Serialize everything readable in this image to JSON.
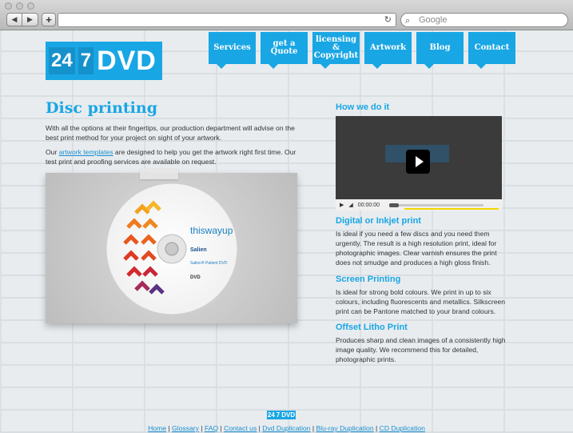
{
  "browser": {
    "url": "",
    "search_placeholder": "Google",
    "add_label": "+",
    "back_label": "◀",
    "forward_label": "▶"
  },
  "logo": {
    "part1": "24",
    "part2": "7",
    "part3": "DVD"
  },
  "nav": [
    {
      "label": "Services"
    },
    {
      "label": "get a Quote"
    },
    {
      "label": "licensing & Copyright"
    },
    {
      "label": "Artwork"
    },
    {
      "label": "Blog"
    },
    {
      "label": "Contact"
    }
  ],
  "main": {
    "title": "Disc printing",
    "intro": "With all the options at their fingertips, our production department will advise on the best print method for your project on sight of your artwork.",
    "templates_pre": "Our ",
    "templates_link": "artwork templates",
    "templates_post": " are designed to help you get the artwork right first time. Our test print and proofing services are available on request."
  },
  "disc": {
    "brand": "thiswayup",
    "label": "Salien",
    "subtitle": "Salien® Patient DVD",
    "dvd_mark": "DVD"
  },
  "how": {
    "title": "How we do it",
    "video_logo": "00",
    "time": "00:00:00"
  },
  "sections": [
    {
      "title": "Digital or Inkjet print",
      "body": "Is ideal if you need a few discs and you need them urgently. The result is a high resolution print, ideal for photographic images. Clear varnish ensures the print does not smudge and produces a high gloss finish."
    },
    {
      "title": "Screen Printing",
      "body": "Is ideal for strong bold colours. We print in up to six colours, including fluorescents and metallics. Silkscreen print can be Pantone matched to your brand colours."
    },
    {
      "title": "Offset Litho Print",
      "body": "Produces sharp and clean images of a consistently high image quality. We recommend this for detailed, photographic prints."
    }
  ],
  "footer": {
    "logo_a": "24",
    "logo_b": "7",
    "logo_c": "DVD",
    "links": [
      "Home",
      "Glossary",
      "FAQ",
      "Contact us",
      "Dvd Duplication",
      "Blu-ray Duplication",
      "CD Duplication"
    ],
    "separator": "|"
  }
}
